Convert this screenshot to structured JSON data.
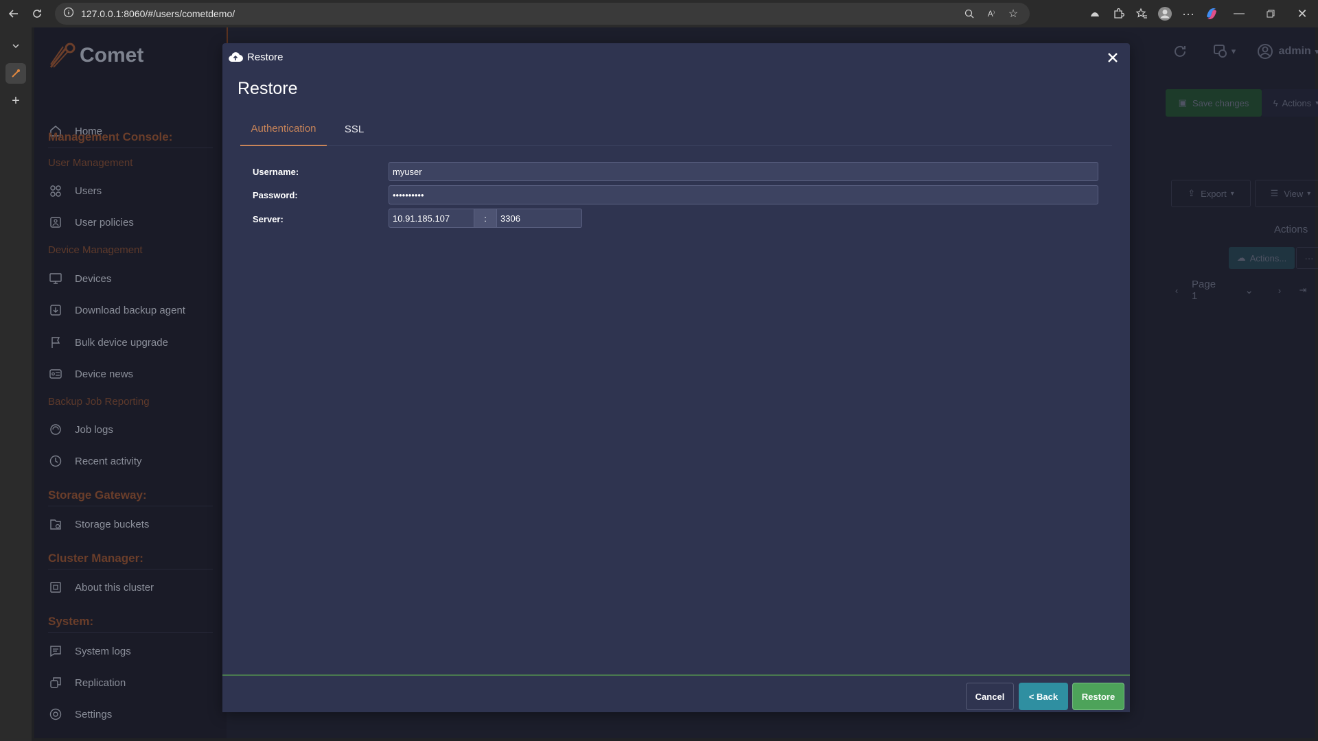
{
  "browser": {
    "url": "127.0.0.1:8060/#/users/cometdemo/",
    "icons": [
      "back-arrow-icon",
      "reload-icon",
      "info-icon",
      "zoom-icon",
      "read-aloud-icon",
      "favorite-star-icon",
      "extension-icon",
      "puzzle-icon",
      "favorites-icon",
      "profile-icon",
      "more-icon",
      "copilot-icon"
    ]
  },
  "sidebar": {
    "brand": "Comet",
    "home": "Home",
    "management_console": "Management Console:",
    "user_management": "User Management",
    "users": "Users",
    "user_policies": "User policies",
    "device_management": "Device Management",
    "devices": "Devices",
    "download_backup_agent": "Download backup agent",
    "bulk_device_upgrade": "Bulk device upgrade",
    "device_news": "Device news",
    "backup_job_reporting": "Backup Job Reporting",
    "job_logs": "Job logs",
    "recent_activity": "Recent activity",
    "storage_gateway": "Storage Gateway:",
    "storage_buckets": "Storage buckets",
    "cluster_manager": "Cluster Manager:",
    "about_this_cluster": "About this cluster",
    "system": "System:",
    "system_logs": "System logs",
    "replication": "Replication",
    "settings": "Settings"
  },
  "background": {
    "admin": "admin",
    "save_changes": "Save changes",
    "actions": "Actions",
    "export": "Export",
    "view": "View",
    "actions_header": "Actions",
    "actions_ellipsis": "Actions...",
    "page": "Page 1"
  },
  "modal": {
    "header_title": "Restore",
    "title": "Restore",
    "tabs": [
      {
        "label": "Authentication",
        "active": true
      },
      {
        "label": "SSL",
        "active": false
      }
    ],
    "fields": {
      "username_label": "Username:",
      "username_value": "myuser",
      "password_label": "Password:",
      "password_value": "••••••••••",
      "server_label": "Server:",
      "server_host": "10.91.185.107",
      "server_separator": ":",
      "server_port": "3306"
    },
    "buttons": {
      "cancel": "Cancel",
      "back": "< Back",
      "restore": "Restore"
    }
  },
  "colors": {
    "accent_orange": "#c98559",
    "modal_bg": "#2f3450",
    "back_button": "#2f8fa1",
    "restore_button": "#4da35a"
  }
}
